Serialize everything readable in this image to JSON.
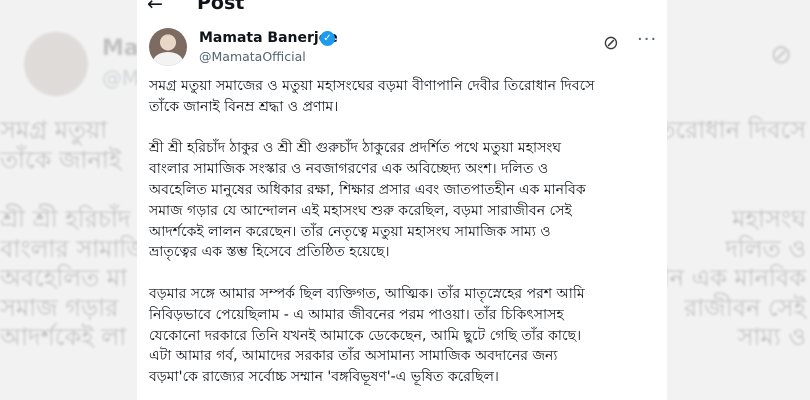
{
  "topbar": {
    "back_icon": "←",
    "title": "Post"
  },
  "author": {
    "name": "Mamata Banerjee",
    "handle": "@MamataOfficial",
    "verified_icon": "✓",
    "grok_icon": "⊘",
    "more_icon": "···"
  },
  "post": {
    "paragraphs": [
      [
        "সমগ্র মতুয়া সমাজের ও মতুয়া মহাসংঘের বড়মা বীণাপানি দেবীর তিরোধান দিবসে",
        "তাঁকে জানাই বিনম্র শ্রদ্ধা ও প্রণাম।"
      ],
      [
        "শ্রী শ্রী হরিচাঁদ ঠাকুর ও শ্রী শ্রী গুরুচাঁদ ঠাকুরের প্রদর্শিত পথে মতুয়া মহাসংঘ",
        "বাংলার সামাজিক সংস্কার ও নবজাগরণের এক অবিচ্ছেদ্য অংশ। দলিত ও",
        "অবহেলিত মানুষের অধিকার রক্ষা, শিক্ষার প্রসার এবং জাতপাতহীন এক মানবিক",
        "সমাজ গড়ার যে আন্দোলন এই মহাসংঘ শুরু করেছিল, বড়মা সারাজীবন সেই",
        "আদর্শকেই লালন করেছেন। তাঁর নেতৃত্বে মতুয়া মহাসংঘ সামাজিক সাম্য ও",
        "ভ্রাতৃত্বের এক স্তম্ভ হিসেবে প্রতিষ্ঠিত হয়েছে।"
      ],
      [
        "বড়মার সঙ্গে আমার সম্পর্ক ছিল ব্যক্তিগত, আত্মিক। তাঁর মাতৃস্নেহের পরশ আমি",
        "নিবিড়ভাবে পেয়েছিলাম - এ আমার জীবনের পরম পাওয়া। তাঁর চিকিৎসাসহ",
        "যেকোনো দরকারে তিনি যখনই আমাকে ডেকেছেন, আমি ছুটে গেছি তাঁর কাছে।",
        "এটা আমার গর্ব, আমাদের সরকার তাঁর অসামান্য সামাজিক অবদানের জন্য",
        "বড়মা'কে রাজ্যের সর্বোচ্চ সম্মান 'বঙ্গবিভূষণ'-এ ভূষিত করেছিল।"
      ]
    ]
  },
  "background": {
    "name": "Mamata",
    "handle": "@Mam",
    "lines": [
      [
        "সমগ্র মতুয়া",
        "তিরোধান দিবসে"
      ],
      [
        "তাঁকে জানাই",
        ""
      ],
      [
        "শ্রী শ্রী হরিচাঁদ",
        "মহাসংঘ"
      ],
      [
        "বাংলার সামাজি",
        "দলিত ও"
      ],
      [
        "অবহেলিত মা",
        "হীন এক মানবিক"
      ],
      [
        "সমাজ গড়ার",
        "রাজীবন সেই"
      ],
      [
        "আদর্শকেই লা",
        "সাম্য ও"
      ]
    ]
  }
}
